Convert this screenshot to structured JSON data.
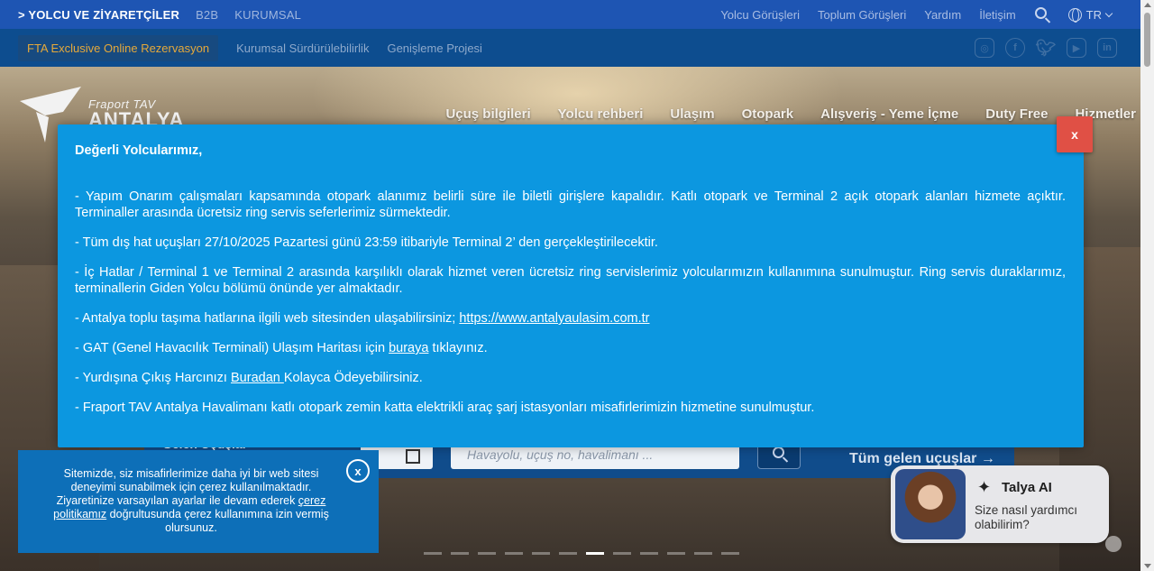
{
  "topbar": {
    "left": [
      {
        "label": "> YOLCU VE ZİYARETÇİLER",
        "active": true
      },
      {
        "label": "B2B",
        "active": false
      },
      {
        "label": "KURUMSAL",
        "active": false
      }
    ],
    "right": [
      "Yolcu Görüşleri",
      "Toplum Görüşleri",
      "Yardım",
      "İletişim"
    ],
    "language": "TR"
  },
  "subbar": {
    "highlight": "FTA Exclusive Online Rezervasyon",
    "links": [
      "Kurumsal Sürdürülebilirlik",
      "Genişleme Projesi"
    ],
    "socials": [
      "instagram-icon",
      "facebook-icon",
      "twitter-icon",
      "youtube-icon",
      "linkedin-icon"
    ]
  },
  "logo": {
    "top": "Fraport TAV",
    "brand": "ANTALYA"
  },
  "mainnav": [
    "Uçuş bilgileri",
    "Yolcu rehberi",
    "Ulaşım",
    "Otopark",
    "Alışveriş - Yeme İçme",
    "Duty Free",
    "Hizmetler"
  ],
  "flight_widget": {
    "tab": "Gelen Uçuşlar",
    "search_placeholder": "Havayolu, uçuş no, havalimanı ...",
    "all_label": "Tüm gelen uçuşlar →"
  },
  "modal": {
    "close_label": "x",
    "title": "Değerli Yolcularımız,",
    "p1": "- Yapım Onarım çalışmaları kapsamında otopark alanımız belirli süre ile biletli girişlere kapalıdır. Katlı otopark ve Terminal 2 açık otopark alanları hizmete açıktır. Terminaller arasında ücretsiz ring servis seferlerimiz sürmektedir.",
    "p2": "- Tüm dış hat uçuşları  27/10/2025 Pazartesi günü 23:59 itibariyle Terminal 2’ den gerçekleştirilecektir.",
    "p3": "- İç Hatlar / Terminal 1 ve Terminal 2 arasında karşılıklı olarak hizmet veren ücretsiz ring servislerimiz yolcularımızın kullanımına sunulmuştur. Ring servis duraklarımız, terminallerin Giden Yolcu bölümü önünde yer almaktadır.",
    "p4_text": "- Antalya toplu taşıma hatlarına ilgili web sitesinden ulaşabilirsiniz; ",
    "p4_link": "https://www.antalyaulasim.com.tr",
    "p5_pre": "- GAT (Genel Havacılık Terminali) Ulaşım Haritası için ",
    "p5_link": "buraya",
    "p5_post": " tıklayınız.",
    "p6_pre": "- Yurdışına Çıkış Harcınızı ",
    "p6_link": "Buradan ",
    "p6_post": "Kolayca Ödeyebilirsiniz.",
    "p7": "- Fraport TAV Antalya Havalimanı katlı otopark zemin katta elektrikli araç şarj istasyonları misafirlerimizin hizmetine sunulmuştur."
  },
  "cookie": {
    "line1": "Sitemizde, siz misafirlerimize daha iyi bir web sitesi deneyimi sunabilmek için çerez kullanılmaktadır.",
    "line2_pre": "Ziyaretinize varsayılan ayarlar ile devam ederek ",
    "link": "çerez politikamız",
    "line2_post": " doğrultusunda çerez kullanımına izin vermiş olursunuz.",
    "close_label": "x"
  },
  "talya": {
    "name": "Talya AI",
    "subtitle": "Size nasıl yardımcı olabilirim?"
  },
  "slider": {
    "total": 12,
    "active": 7
  }
}
